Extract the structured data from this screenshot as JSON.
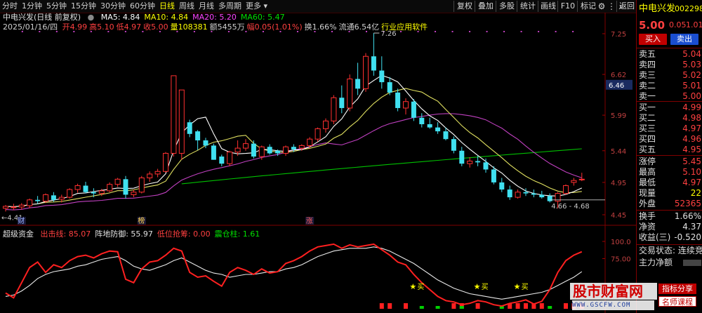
{
  "toolbar": {
    "periods": [
      "分时",
      "1分钟",
      "5分钟",
      "15分钟",
      "30分钟",
      "60分钟",
      "日线",
      "周线",
      "月线",
      "多周期",
      "更多"
    ],
    "active_period": "日线",
    "buttons": [
      "复权",
      "叠加",
      "多股",
      "统计",
      "画线",
      "F10",
      "标记"
    ],
    "back_label": "返回",
    "icons": [
      "gear-icon",
      "dots-icon",
      "search-icon"
    ]
  },
  "header": {
    "stock_title": "中电兴发(日线 前复权)",
    "ma": [
      {
        "label": "MA5: 4.84",
        "color": "#ffffff"
      },
      {
        "label": "MA10: 4.84",
        "color": "#ffff00"
      },
      {
        "label": "MA20: 5.20",
        "color": "#ff44ff"
      },
      {
        "label": "MA60: 5.47",
        "color": "#00e000"
      }
    ],
    "info_date": "2025/01/16/四",
    "info_items": [
      {
        "text": "开4.99",
        "color": "#ff4040"
      },
      {
        "text": "高5.10",
        "color": "#ff4040"
      },
      {
        "text": "低4.97",
        "color": "#ff4040"
      },
      {
        "text": "收5.00",
        "color": "#ff4040"
      },
      {
        "text": "量108381",
        "color": "#ffff00"
      },
      {
        "text": "额5455万",
        "color": "#d0d0d0"
      },
      {
        "text": "幅0.05(1.01%)",
        "color": "#ff4040"
      },
      {
        "text": "换1.66%",
        "color": "#d0d0d0"
      },
      {
        "text": "流通6.54亿",
        "color": "#d0d0d0"
      },
      {
        "text": "行业应用软件",
        "color": "#ffff00"
      }
    ]
  },
  "price_axis": {
    "ticks": [
      {
        "label": "7.25",
        "value": 7.25
      },
      {
        "label": "6.62",
        "value": 6.62
      },
      {
        "label": "5.99",
        "value": 5.99
      },
      {
        "label": "5.44",
        "value": 5.44
      },
      {
        "label": "4.95",
        "value": 4.95
      },
      {
        "label": "4.45",
        "value": 4.45
      }
    ],
    "current_label": "6.46",
    "current_value": 6.46,
    "value_top": 7.25,
    "value_bottom": 4.45
  },
  "annotations": {
    "high_label": "7.26",
    "low_label": "4.41",
    "range_label": "4.66 - 4.68",
    "events": [
      {
        "label": "财",
        "index": 2,
        "color": "#9ab0ff"
      },
      {
        "label": "榜",
        "index": 17,
        "color": "#ffd24c"
      },
      {
        "label": "涨",
        "index": 38,
        "color": "#ff5a5a"
      }
    ]
  },
  "ind_header": {
    "name": "超级资金",
    "items": [
      {
        "text": "出击线: 85.07",
        "color": "#ff4040"
      },
      {
        "text": "阵地防御: 55.97",
        "color": "#e0e0e0"
      },
      {
        "text": "低位抢筹: 0.00",
        "color": "#ff4040"
      },
      {
        "text": "震仓柱: 1.61",
        "color": "#00e000"
      }
    ],
    "axis": [
      {
        "label": "100.0",
        "value": 100
      },
      {
        "label": "75.00",
        "value": 75
      },
      {
        "label": "25.00",
        "value": 25
      }
    ],
    "markers": [
      {
        "label": "买",
        "index": 51
      },
      {
        "label": "买",
        "index": 59
      },
      {
        "label": "买",
        "index": 64
      }
    ]
  },
  "candles": [
    [
      4.55,
      4.6,
      4.5,
      4.58
    ],
    [
      4.56,
      4.62,
      4.52,
      4.57
    ],
    [
      4.57,
      4.63,
      4.53,
      4.6
    ],
    [
      4.59,
      4.7,
      4.55,
      4.68
    ],
    [
      4.68,
      4.74,
      4.62,
      4.66
    ],
    [
      4.66,
      4.78,
      4.63,
      4.76
    ],
    [
      4.75,
      4.8,
      4.65,
      4.68
    ],
    [
      4.69,
      4.76,
      4.64,
      4.72
    ],
    [
      4.72,
      4.86,
      4.7,
      4.84
    ],
    [
      4.84,
      4.93,
      4.79,
      4.9
    ],
    [
      4.9,
      4.96,
      4.78,
      4.8
    ],
    [
      4.8,
      4.86,
      4.72,
      4.78
    ],
    [
      4.78,
      4.85,
      4.74,
      4.82
    ],
    [
      4.82,
      4.95,
      4.8,
      4.92
    ],
    [
      4.92,
      5.02,
      4.88,
      5.0
    ],
    [
      5.0,
      5.05,
      4.7,
      4.76
    ],
    [
      4.76,
      4.84,
      4.72,
      4.8
    ],
    [
      4.8,
      5.05,
      4.78,
      5.02
    ],
    [
      5.02,
      5.12,
      4.96,
      5.08
    ],
    [
      5.08,
      5.16,
      5.03,
      5.12
    ],
    [
      5.12,
      5.42,
      5.1,
      5.4
    ],
    [
      5.4,
      6.6,
      5.35,
      6.6
    ],
    [
      5.4,
      6.3,
      5.3,
      6.38
    ],
    [
      5.88,
      5.92,
      5.65,
      5.7
    ],
    [
      5.74,
      5.76,
      5.45,
      5.6
    ],
    [
      5.6,
      5.64,
      5.48,
      5.52
    ],
    [
      5.52,
      5.55,
      5.3,
      5.3
    ],
    [
      5.35,
      5.38,
      5.2,
      5.24
    ],
    [
      5.24,
      5.44,
      5.2,
      5.42
    ],
    [
      5.42,
      5.6,
      5.36,
      5.48
    ],
    [
      5.48,
      5.62,
      5.44,
      5.55
    ],
    [
      5.55,
      5.6,
      5.32,
      5.35
    ],
    [
      5.35,
      5.52,
      5.3,
      5.5
    ],
    [
      5.5,
      5.54,
      5.38,
      5.4
    ],
    [
      5.44,
      5.46,
      5.36,
      5.4
    ],
    [
      5.4,
      5.52,
      5.36,
      5.5
    ],
    [
      5.5,
      5.54,
      5.42,
      5.46
    ],
    [
      5.48,
      5.54,
      5.44,
      5.52
    ],
    [
      5.52,
      5.65,
      5.48,
      5.62
    ],
    [
      5.62,
      5.8,
      5.58,
      5.78
    ],
    [
      5.78,
      5.94,
      5.72,
      5.9
    ],
    [
      5.9,
      6.3,
      5.85,
      6.26
    ],
    [
      6.26,
      6.45,
      6.02,
      6.1
    ],
    [
      6.1,
      6.62,
      6.05,
      6.55
    ],
    [
      6.55,
      6.8,
      6.3,
      6.4
    ],
    [
      6.4,
      6.95,
      6.35,
      6.9
    ],
    [
      6.9,
      7.26,
      6.6,
      6.68
    ],
    [
      6.68,
      6.9,
      6.4,
      6.5
    ],
    [
      6.5,
      6.58,
      6.3,
      6.34
    ],
    [
      6.34,
      6.4,
      6.05,
      6.1
    ],
    [
      6.1,
      6.25,
      6.0,
      6.2
    ],
    [
      6.2,
      6.24,
      5.9,
      5.95
    ],
    [
      5.95,
      6.02,
      5.8,
      5.85
    ],
    [
      5.85,
      5.95,
      5.78,
      5.8
    ],
    [
      5.8,
      5.88,
      5.7,
      5.74
    ],
    [
      5.74,
      5.8,
      5.6,
      5.62
    ],
    [
      5.62,
      5.66,
      5.4,
      5.44
    ],
    [
      5.44,
      5.5,
      5.2,
      5.24
    ],
    [
      5.24,
      5.34,
      5.18,
      5.28
    ],
    [
      5.28,
      5.36,
      5.2,
      5.26
    ],
    [
      5.26,
      5.32,
      5.1,
      5.15
    ],
    [
      5.15,
      5.2,
      4.92,
      4.95
    ],
    [
      4.95,
      5.02,
      4.8,
      4.84
    ],
    [
      4.84,
      4.9,
      4.68,
      4.72
    ],
    [
      4.72,
      4.84,
      4.7,
      4.8
    ],
    [
      4.8,
      4.86,
      4.74,
      4.78
    ],
    [
      4.78,
      4.84,
      4.72,
      4.76
    ],
    [
      4.76,
      4.82,
      4.7,
      4.72
    ],
    [
      4.74,
      4.78,
      4.64,
      4.66
    ],
    [
      4.66,
      4.8,
      4.55,
      4.78
    ],
    [
      4.78,
      4.92,
      4.76,
      4.9
    ],
    [
      4.95,
      5.02,
      4.9,
      4.98
    ],
    [
      4.99,
      5.1,
      4.97,
      5.0
    ]
  ],
  "indicator": {
    "red": [
      25,
      18,
      40,
      62,
      70,
      55,
      66,
      62,
      72,
      78,
      80,
      76,
      82,
      86,
      85,
      45,
      40,
      60,
      70,
      72,
      80,
      90,
      86,
      55,
      48,
      50,
      42,
      35,
      55,
      62,
      58,
      52,
      60,
      54,
      56,
      68,
      72,
      78,
      86,
      92,
      94,
      96,
      90,
      95,
      92,
      94,
      96,
      88,
      80,
      70,
      66,
      52,
      40,
      30,
      20,
      14,
      12,
      8,
      10,
      14,
      12,
      8,
      6,
      10,
      12,
      15,
      9,
      13,
      30,
      55,
      72,
      80,
      85
    ],
    "white": [
      20,
      22,
      28,
      36,
      46,
      52,
      56,
      58,
      60,
      64,
      66,
      70,
      74,
      76,
      78,
      72,
      64,
      60,
      58,
      62,
      66,
      72,
      76,
      70,
      64,
      58,
      54,
      52,
      48,
      50,
      52,
      52,
      54,
      56,
      56,
      60,
      62,
      66,
      72,
      78,
      82,
      86,
      88,
      90,
      90,
      90,
      92,
      90,
      86,
      80,
      74,
      68,
      60,
      52,
      44,
      38,
      32,
      28,
      24,
      22,
      20,
      18,
      16,
      18,
      20,
      22,
      24,
      26,
      30,
      36,
      42,
      48,
      56
    ],
    "bars_red": [
      47,
      48,
      50,
      56,
      57,
      59,
      63,
      64,
      65,
      66,
      67,
      70,
      71,
      72
    ],
    "bars_green": [
      52,
      54,
      57,
      62,
      68
    ]
  },
  "quote": {
    "name": "中电兴发",
    "code": "002298",
    "price": "5.00",
    "change": "0.05",
    "pct": "1.01",
    "buy_label": "买入",
    "sell_label": "卖出",
    "sell_book": [
      {
        "label": "卖五",
        "price": "5.04"
      },
      {
        "label": "卖四",
        "price": "5.03"
      },
      {
        "label": "卖三",
        "price": "5.02"
      },
      {
        "label": "卖二",
        "price": "5.01"
      },
      {
        "label": "卖一",
        "price": "5.00"
      }
    ],
    "buy_book": [
      {
        "label": "买一",
        "price": "4.99"
      },
      {
        "label": "买二",
        "price": "4.98"
      },
      {
        "label": "买三",
        "price": "4.97"
      },
      {
        "label": "买四",
        "price": "4.96"
      },
      {
        "label": "买五",
        "price": "4.95"
      }
    ],
    "stats": [
      {
        "label": "涨停",
        "value": "5.45",
        "color": "#ff4040"
      },
      {
        "label": "最高",
        "value": "5.10",
        "color": "#ff4040"
      },
      {
        "label": "最低",
        "value": "4.97",
        "color": "#ff4040"
      },
      {
        "label": "现量",
        "value": "22",
        "color": "#ffff00"
      },
      {
        "label": "外盘",
        "value": "52365",
        "color": "#ff4040"
      }
    ],
    "stats2": [
      {
        "label": "换手",
        "value": "1.66%",
        "color": "#e0e0e0"
      },
      {
        "label": "净资",
        "value": "4.37",
        "color": "#e0e0e0"
      },
      {
        "label": "收益(三)",
        "value": "-0.520",
        "color": "#e0e0e0"
      }
    ],
    "status": "交易状态: 连续竞",
    "main_flow": "主力净额"
  },
  "watermark": {
    "main": "股市财富网",
    "url": "WWW.GSCFW.COM",
    "tag1": "指标分享",
    "tag2": "名师课程"
  }
}
